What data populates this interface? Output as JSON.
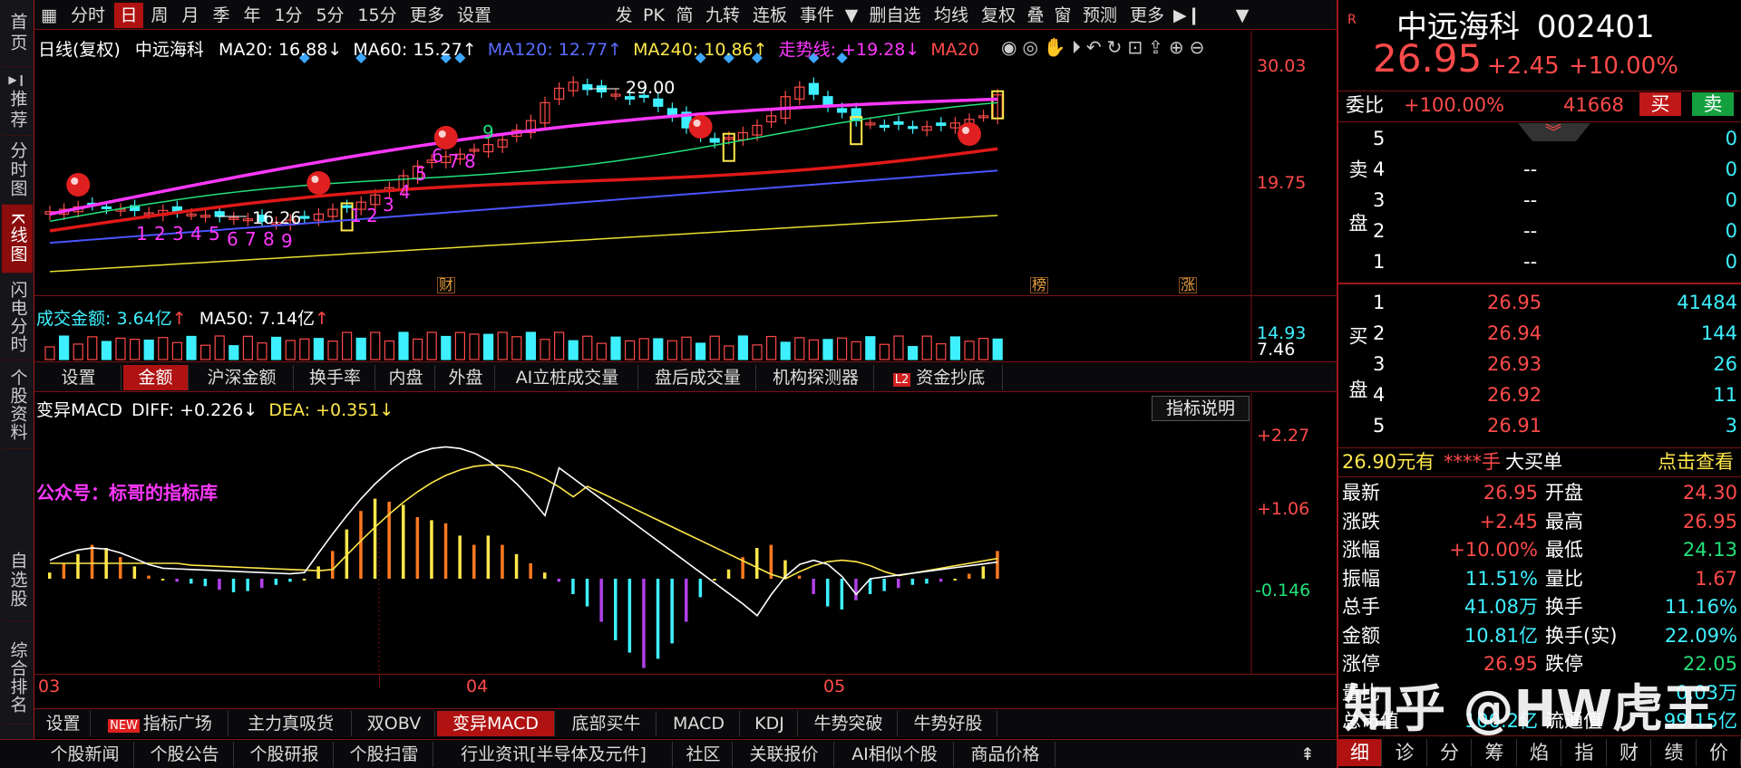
{
  "sidebar": {
    "items": [
      {
        "label": "首页"
      },
      {
        "label": "推荐"
      },
      {
        "label": "分时图"
      },
      {
        "label": "K线图"
      },
      {
        "label": "闪电分时"
      },
      {
        "label": "个股资料"
      },
      {
        "label": "自选股"
      },
      {
        "label": "综合排名"
      }
    ]
  },
  "toolbar": {
    "left": [
      "分时",
      "日",
      "周",
      "月",
      "季",
      "年",
      "1分",
      "5分",
      "15分",
      "更多",
      "设置"
    ],
    "right": [
      "发",
      "PK",
      "简",
      "九转",
      "连板",
      "事件",
      "删自选",
      "均线",
      "复权",
      "叠",
      "窗",
      "预测",
      "更多"
    ],
    "active_period": "日"
  },
  "main_chart": {
    "legend": {
      "period": "日线(复权)",
      "stock": "中远海科",
      "ma20": "MA20: 16.88↓",
      "ma60": "MA60: 15.27↑",
      "ma120": "MA120: 12.77↑",
      "ma240": "MA240: 10.86↑",
      "trend": "走势线: +19.28↓",
      "ma_cut": "MA20"
    },
    "y_labels": [
      "30.03",
      "19.75"
    ],
    "annotations": {
      "high": "29.00",
      "low": "16.26",
      "mark_cai": "财",
      "mark_bang": "榜",
      "mark_zhang": "涨"
    },
    "counts_a": [
      "1",
      "2",
      "3",
      "4",
      "5",
      "6",
      "7",
      "8",
      "9"
    ],
    "counts_b": [
      "1",
      "2",
      "3",
      "4",
      "5",
      "6",
      "7",
      "8",
      "9"
    ]
  },
  "volume": {
    "legend_amount": "成交金额: 3.64亿",
    "legend_ma50": "MA50: 7.14亿",
    "y1": "14.93",
    "y2": "7.46"
  },
  "vol_tabs": [
    "设置",
    "金额",
    "沪深金额",
    "换手率",
    "内盘",
    "外盘",
    "AI立桩成交量",
    "盘后成交量",
    "机构探测器",
    "资金抄底"
  ],
  "vol_tabs_active": "金额",
  "vol_tabs_l2": "L2",
  "macd": {
    "title": "变异MACD",
    "diff": "DIFF: +0.226↓",
    "dea": "DEA: +0.351↓",
    "watermark_text": "公众号：标哥的指标库",
    "help_btn": "指标说明",
    "y_labels": [
      "+2.27",
      "+1.06",
      "-0.146"
    ]
  },
  "date_axis": [
    "03",
    "04",
    "05"
  ],
  "indicator_tabs": [
    "设置",
    "指标广场",
    "主力真吸货",
    "双OBV",
    "变异MACD",
    "底部买牛",
    "MACD",
    "KDJ",
    "牛势突破",
    "牛势好股"
  ],
  "indicator_tabs_active": "变异MACD",
  "indicator_new_badge": "NEW",
  "news_bar": [
    "个股新闻",
    "个股公告",
    "个股研报",
    "个股扫雷",
    "行业资讯[半导体及元件]",
    "社区",
    "关联报价",
    "AI相似个股",
    "商品价格"
  ],
  "right_panel": {
    "r_tag": "R",
    "name": "中远海科",
    "code": "002401",
    "price": "26.95",
    "change": "+2.45",
    "change_pct": "+10.00%",
    "weibi_label": "委比",
    "weibi": "+100.00%",
    "weicha": "41668",
    "buy_btn": "买",
    "sell_btn": "卖",
    "sell_side_label": "卖盘",
    "buy_side_label": "买盘",
    "sell_levels": [
      {
        "n": "5",
        "price": "",
        "vol": "0"
      },
      {
        "n": "4",
        "price": "--",
        "vol": "0"
      },
      {
        "n": "3",
        "price": "--",
        "vol": "0"
      },
      {
        "n": "2",
        "price": "--",
        "vol": "0"
      },
      {
        "n": "1",
        "price": "--",
        "vol": "0"
      }
    ],
    "buy_levels": [
      {
        "n": "1",
        "price": "26.95",
        "vol": "41484"
      },
      {
        "n": "2",
        "price": "26.94",
        "vol": "144"
      },
      {
        "n": "3",
        "price": "26.93",
        "vol": "26"
      },
      {
        "n": "4",
        "price": "26.92",
        "vol": "11"
      },
      {
        "n": "5",
        "price": "26.91",
        "vol": "3"
      }
    ],
    "big_order": {
      "price": "26.90元有",
      "mask": "****手",
      "label": "大买单",
      "link": "点击查看"
    },
    "stats": [
      {
        "k1": "最新",
        "v1": "26.95",
        "c1": "red",
        "k2": "开盘",
        "v2": "24.30",
        "c2": "red"
      },
      {
        "k1": "涨跌",
        "v1": "+2.45",
        "c1": "red",
        "k2": "最高",
        "v2": "26.95",
        "c2": "red"
      },
      {
        "k1": "涨幅",
        "v1": "+10.00%",
        "c1": "red",
        "k2": "最低",
        "v2": "24.13",
        "c2": "green"
      },
      {
        "k1": "振幅",
        "v1": "11.51%",
        "c1": "cyan",
        "k2": "量比",
        "v2": "1.67",
        "c2": "red"
      },
      {
        "k1": "总手",
        "v1": "41.08万",
        "c1": "cyan",
        "k2": "换手",
        "v2": "11.16%",
        "c2": "cyan"
      },
      {
        "k1": "金额",
        "v1": "10.81亿",
        "c1": "cyan",
        "k2": "换手(实)",
        "v2": "22.09%",
        "c2": "cyan"
      },
      {
        "k1": "涨停",
        "v1": "26.95",
        "c1": "red",
        "k2": "跌停",
        "v2": "22.05",
        "c2": "green"
      },
      {
        "k1": "量比",
        "v1": "",
        "c1": "cyan",
        "k2": "",
        "v2": "0.03万",
        "c2": "cyan"
      },
      {
        "k1": "总市值",
        "v1": "100.2亿",
        "c1": "cyan",
        "k2": "流通值",
        "v2": "99.15亿",
        "c2": "cyan"
      }
    ],
    "bottom_tabs": [
      "细",
      "诊",
      "分",
      "筹",
      "焰",
      "指",
      "财",
      "绩",
      "价"
    ],
    "bottom_active": "细",
    "watermark": "知乎 @HW虎王"
  },
  "colors": {
    "up": "#ff4a4a",
    "down": "#3ef0ff",
    "ma20": "#ff38ff",
    "ma60": "#e01818",
    "ma120": "#4a54ff",
    "ma240": "#e8e030",
    "bg": "#000000",
    "accent": "#b01212"
  }
}
